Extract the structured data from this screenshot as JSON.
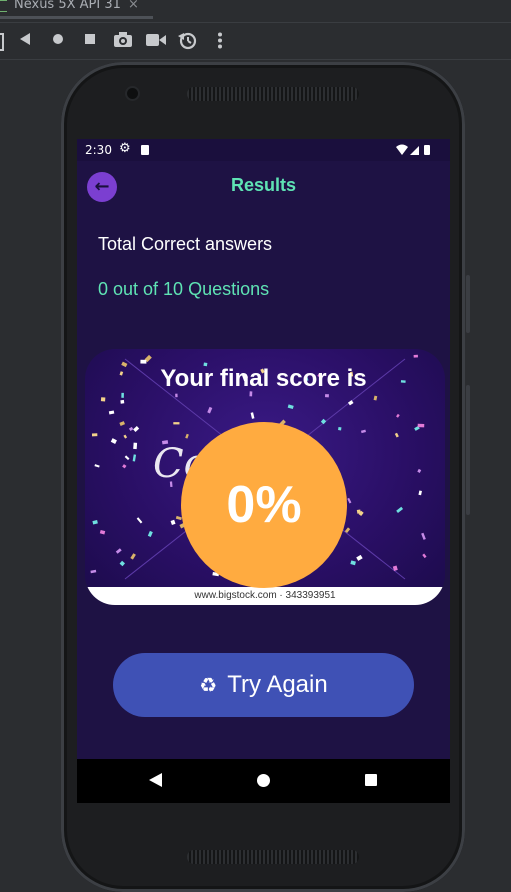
{
  "emulator": {
    "tab_title": "Nexus 5X API 31",
    "tab_close": "×",
    "toolbar_icons": [
      "power-icon",
      "rotate-left-icon",
      "home-icon",
      "stop-icon",
      "camera-icon",
      "video-icon",
      "rotate-icon",
      "more-icon"
    ]
  },
  "status_bar": {
    "time": "2:30",
    "settings_glyph": "⚙"
  },
  "app_bar": {
    "title": "Results",
    "back_glyph": "←"
  },
  "results": {
    "total_label": "Total Correct answers",
    "score_text": "0 out of 10 Questions"
  },
  "banner": {
    "heading": "Your final score is",
    "score_percent": "0%",
    "partial_text": "Cong",
    "watermark": "www.bigstock.com · 343393951"
  },
  "try_again": {
    "icon": "♻",
    "label": "Try Again"
  },
  "colors": {
    "screen_bg": "#1e1244",
    "accent_green": "#5fe3b4",
    "score_circle": "#ffab40",
    "button_bg": "#3f51b5",
    "back_button": "#7b3fd1"
  }
}
